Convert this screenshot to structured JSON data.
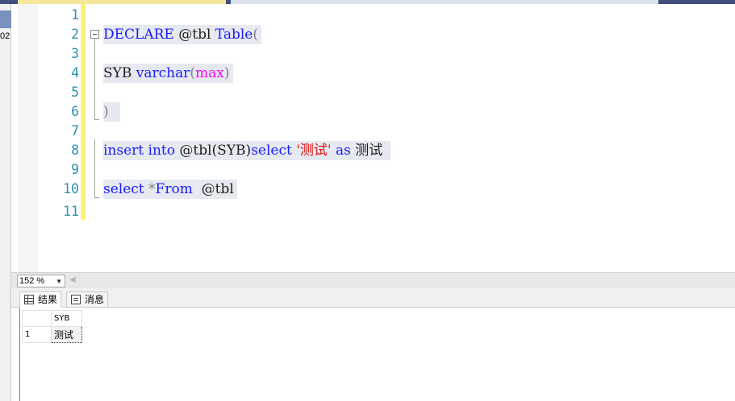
{
  "left_panel": {
    "partial_text": "02"
  },
  "editor": {
    "lines": [
      {
        "num": "1",
        "code": ""
      },
      {
        "num": "2",
        "code": "DECLARE @tbl Table("
      },
      {
        "num": "3",
        "code": ""
      },
      {
        "num": "4",
        "code": "SYB varchar(max)"
      },
      {
        "num": "5",
        "code": ""
      },
      {
        "num": "6",
        "code": ")"
      },
      {
        "num": "7",
        "code": ""
      },
      {
        "num": "8",
        "code": "insert into @tbl(SYB)select '测试' as 测试"
      },
      {
        "num": "9",
        "code": ""
      },
      {
        "num": "10",
        "code": "select *From  @tbl"
      },
      {
        "num": "11",
        "code": ""
      }
    ],
    "tokens": {
      "declare": "DECLARE",
      "tbl_var": " @tbl ",
      "table_kw": "Table",
      "paren_open": "(",
      "syb": "SYB ",
      "varchar": "varchar",
      "max": "max",
      "paren_close": ")",
      "insert": "insert",
      "space": " ",
      "into": "into",
      "tbl_syb": " @tbl(SYB)",
      "select": "select",
      "str_val": "'测试'",
      "as": "as",
      "alias": " 测试",
      "select2": "select",
      "star": " *",
      "from": "From",
      "tbl_end": "  @tbl"
    }
  },
  "zoom": {
    "value": "152 %"
  },
  "results": {
    "tabs": [
      {
        "label": "结果",
        "icon": "grid-icon"
      },
      {
        "label": "消息",
        "icon": "message-icon"
      }
    ],
    "columns": [
      "SYB"
    ],
    "rows": [
      {
        "num": "1",
        "cells": [
          "测试"
        ]
      }
    ]
  },
  "colors": {
    "keyword": "#1a1aff",
    "function": "#ff00ff",
    "string": "#e01010",
    "line_number": "#2b91af",
    "change_bar": "#fdf07a"
  }
}
